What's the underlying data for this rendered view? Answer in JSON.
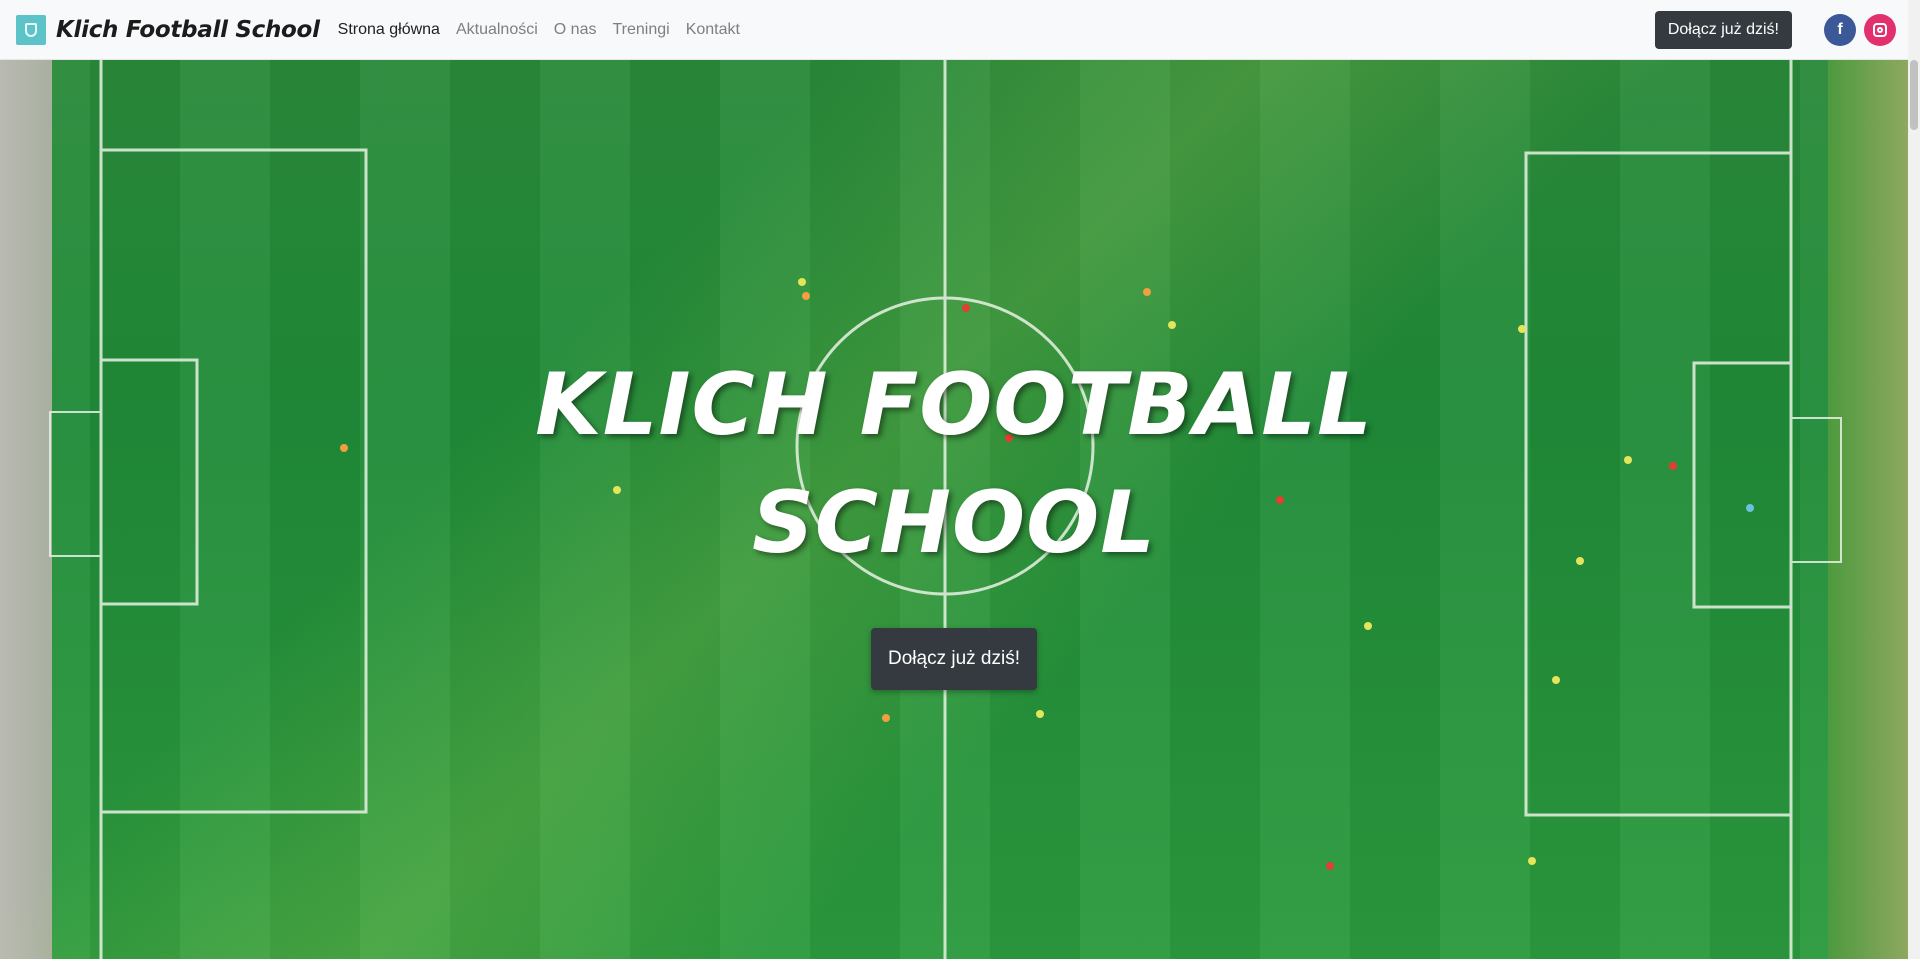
{
  "nav": {
    "brand": "Klich Football School",
    "links": [
      {
        "label": "Strona główna",
        "active": true
      },
      {
        "label": "Aktualności",
        "active": false
      },
      {
        "label": "O nas",
        "active": false
      },
      {
        "label": "Treningi",
        "active": false
      },
      {
        "label": "Kontakt",
        "active": false
      }
    ],
    "cta_label": "Dołącz już dziś!",
    "social": [
      {
        "icon": "facebook-icon",
        "glyph": "f",
        "color": "#3b5998"
      },
      {
        "icon": "instagram-icon",
        "color": "#e1306c"
      }
    ]
  },
  "hero": {
    "title": "KLICH FOOTBALL SCHOOL",
    "cta_label": "Dołącz już dziś!",
    "background": "football-pitch-aerial-image"
  },
  "colors": {
    "navbar_bg": "#f8f9fa",
    "button_dark": "#343a40",
    "pitch_green": "#1f8b38",
    "brand_logo": "#5cc4c8"
  }
}
